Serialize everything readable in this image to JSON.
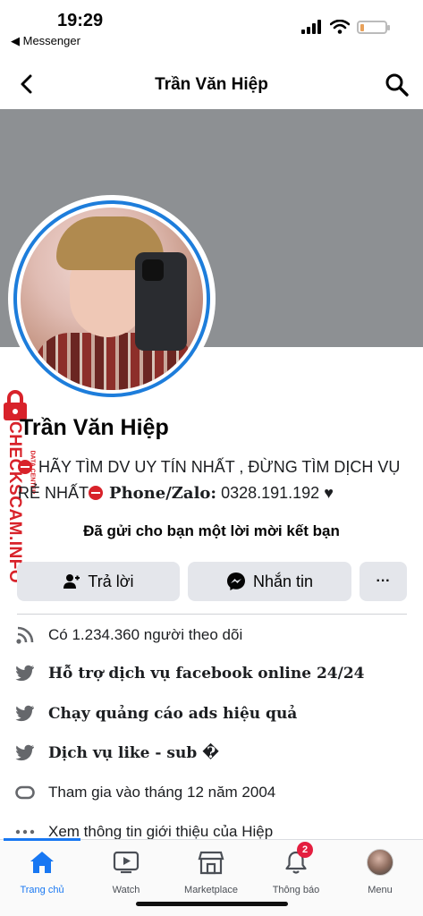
{
  "status": {
    "time": "19:29",
    "back_app": "◀ Messenger"
  },
  "nav": {
    "title": "Trần Văn Hiệp"
  },
  "profile": {
    "name": "Trần Văn Hiệp",
    "bio_line1": " HÃY TÌM DV UY TÍN NHẤT , ĐỪNG TÌM DỊCH VỤ",
    "bio_line2_start": "RẺ NHẤT",
    "bio_phone_label": "Phone/Zalo:",
    "bio_phone": " 0328.191.192 ♥"
  },
  "friend_request": "Đã gửi cho bạn một lời mời kết bạn",
  "actions": {
    "reply": "Trả lời",
    "message": "Nhắn tin",
    "more": "···"
  },
  "info": [
    {
      "icon": "rss-icon",
      "text": "Có 1.234.360 người theo dõi"
    },
    {
      "icon": "twitter-icon",
      "text": "Hỗ trợ dịch vụ facebook online 24/24"
    },
    {
      "icon": "twitter-icon",
      "text": "Chạy quảng cáo ads hiệu quả"
    },
    {
      "icon": "twitter-icon",
      "text": "Dịch vụ like - sub �"
    },
    {
      "icon": "joined-icon",
      "text": "Tham gia vào tháng 12 năm 2004"
    },
    {
      "icon": "more-dots-icon",
      "text": "Xem thông tin giới thiệu của Hiệp"
    }
  ],
  "watermark": {
    "main": "CHECKSCAM.INFO",
    "sub": "DATA CENTER"
  },
  "tabs": [
    {
      "label": "Trang chủ",
      "icon": "home-icon",
      "active": true
    },
    {
      "label": "Watch",
      "icon": "watch-icon"
    },
    {
      "label": "Marketplace",
      "icon": "marketplace-icon"
    },
    {
      "label": "Thông báo",
      "icon": "bell-icon",
      "badge": "2"
    },
    {
      "label": "Menu",
      "icon": "menu-avatar-icon"
    }
  ],
  "colors": {
    "accent": "#1877f2",
    "cover": "#8d9093",
    "watermark": "#d8222a"
  }
}
